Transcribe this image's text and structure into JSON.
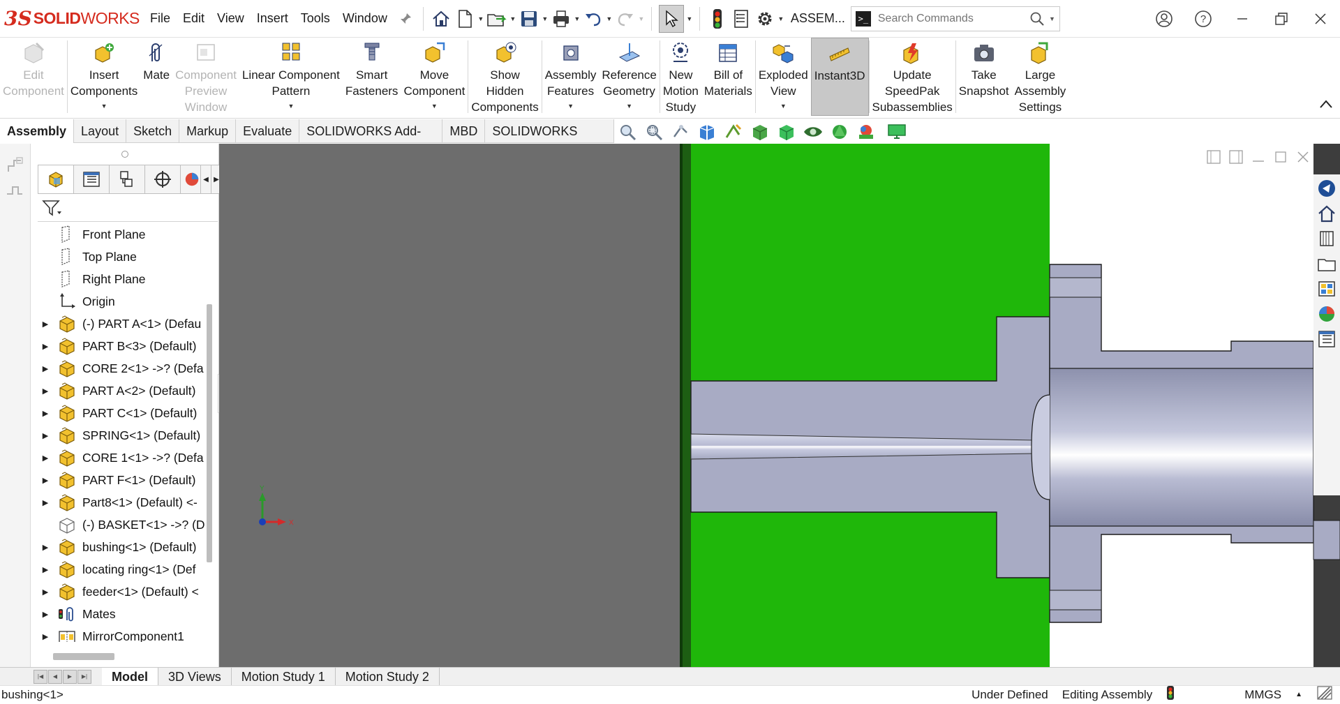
{
  "app": {
    "brand_ds": "3S",
    "brand_solid": "SOLID",
    "brand_works": "WORKS",
    "document_name": "ASSEM..."
  },
  "menu": [
    "File",
    "Edit",
    "View",
    "Insert",
    "Tools",
    "Window"
  ],
  "search": {
    "placeholder": "Search Commands",
    "prompt_glyph": ">_"
  },
  "command_manager": [
    {
      "id": "edit-component",
      "lines": [
        "Edit",
        "Component"
      ],
      "icon": "edit-component-icon",
      "enabled": false,
      "dropdown": false
    },
    {
      "id": "insert-components",
      "lines": [
        "Insert",
        "Components"
      ],
      "icon": "insert-components-icon",
      "enabled": true,
      "dropdown": true
    },
    {
      "id": "mate",
      "lines": [
        "Mate"
      ],
      "icon": "mate-paperclip-icon",
      "enabled": true,
      "dropdown": false
    },
    {
      "id": "component-preview-window",
      "lines": [
        "Component",
        "Preview",
        "Window"
      ],
      "icon": "preview-window-icon",
      "enabled": false,
      "dropdown": false
    },
    {
      "id": "linear-component-pattern",
      "lines": [
        "Linear Component",
        "Pattern"
      ],
      "icon": "linear-pattern-icon",
      "enabled": true,
      "dropdown": true
    },
    {
      "id": "smart-fasteners",
      "lines": [
        "Smart",
        "Fasteners"
      ],
      "icon": "smart-fasteners-icon",
      "enabled": true,
      "dropdown": false
    },
    {
      "id": "move-component",
      "lines": [
        "Move",
        "Component"
      ],
      "icon": "move-component-icon",
      "enabled": true,
      "dropdown": true
    },
    {
      "id": "show-hidden-components",
      "lines": [
        "Show",
        "Hidden",
        "Components"
      ],
      "icon": "show-hidden-icon",
      "enabled": true,
      "dropdown": false
    },
    {
      "id": "assembly-features",
      "lines": [
        "Assembly",
        "Features"
      ],
      "icon": "assembly-features-icon",
      "enabled": true,
      "dropdown": true
    },
    {
      "id": "reference-geometry",
      "lines": [
        "Reference",
        "Geometry"
      ],
      "icon": "reference-geometry-icon",
      "enabled": true,
      "dropdown": true
    },
    {
      "id": "new-motion-study",
      "lines": [
        "New",
        "Motion",
        "Study"
      ],
      "icon": "motion-study-icon",
      "enabled": true,
      "dropdown": false
    },
    {
      "id": "bill-of-materials",
      "lines": [
        "Bill of",
        "Materials"
      ],
      "icon": "bill-of-materials-icon",
      "enabled": true,
      "dropdown": false
    },
    {
      "id": "exploded-view",
      "lines": [
        "Exploded",
        "View"
      ],
      "icon": "exploded-view-icon",
      "enabled": true,
      "dropdown": true
    },
    {
      "id": "instant3d",
      "lines": [
        "Instant3D"
      ],
      "icon": "instant3d-icon",
      "enabled": true,
      "dropdown": false,
      "active": true
    },
    {
      "id": "update-speedpak",
      "lines": [
        "Update",
        "SpeedPak",
        "Subassemblies"
      ],
      "icon": "speedpak-icon",
      "enabled": true,
      "dropdown": false
    },
    {
      "id": "take-snapshot",
      "lines": [
        "Take",
        "Snapshot"
      ],
      "icon": "camera-icon",
      "enabled": true,
      "dropdown": false
    },
    {
      "id": "large-assembly-settings",
      "lines": [
        "Large",
        "Assembly",
        "Settings"
      ],
      "icon": "large-assembly-icon",
      "enabled": true,
      "dropdown": false
    }
  ],
  "tabs": [
    {
      "label": "Assembly",
      "active": true
    },
    {
      "label": "Layout"
    },
    {
      "label": "Sketch"
    },
    {
      "label": "Markup"
    },
    {
      "label": "Evaluate"
    },
    {
      "label": "SOLIDWORKS Add-Ins"
    },
    {
      "label": "MBD"
    },
    {
      "label": "SOLIDWORKS CAM"
    }
  ],
  "tree": [
    {
      "label": "Front Plane",
      "icon": "plane-icon",
      "expandable": false
    },
    {
      "label": "Top Plane",
      "icon": "plane-icon",
      "expandable": false
    },
    {
      "label": "Right Plane",
      "icon": "plane-icon",
      "expandable": false
    },
    {
      "label": "Origin",
      "icon": "origin-icon",
      "expandable": false
    },
    {
      "label": "(-) PART A<1> (Defau",
      "icon": "part-icon",
      "expandable": true
    },
    {
      "label": "PART B<3> (Default)",
      "icon": "part-icon",
      "expandable": true
    },
    {
      "label": "CORE 2<1> ->? (Defa",
      "icon": "part-icon",
      "expandable": true
    },
    {
      "label": "PART A<2> (Default)",
      "icon": "part-icon",
      "expandable": true
    },
    {
      "label": "PART C<1> (Default)",
      "icon": "part-icon",
      "expandable": true
    },
    {
      "label": "SPRING<1> (Default)",
      "icon": "part-icon",
      "expandable": true
    },
    {
      "label": "CORE 1<1> ->? (Defa",
      "icon": "part-icon",
      "expandable": true
    },
    {
      "label": "PART F<1> (Default)",
      "icon": "part-icon",
      "expandable": true
    },
    {
      "label": "Part8<1> (Default) <-",
      "icon": "part-icon",
      "expandable": true
    },
    {
      "label": "(-) BASKET<1> ->? (D",
      "icon": "part-hidden-icon",
      "expandable": false
    },
    {
      "label": "bushing<1> (Default)",
      "icon": "part-icon",
      "expandable": true
    },
    {
      "label": "locating ring<1> (Def",
      "icon": "part-icon",
      "expandable": true
    },
    {
      "label": "feeder<1> (Default) <",
      "icon": "part-icon",
      "expandable": true
    },
    {
      "label": "Mates",
      "icon": "mates-icon",
      "expandable": true
    },
    {
      "label": "MirrorComponent1",
      "icon": "mirror-component-icon",
      "expandable": true
    }
  ],
  "triad": {
    "y": "Y",
    "x": "X"
  },
  "bottom_tabs": [
    {
      "label": "Model",
      "active": true
    },
    {
      "label": "3D Views"
    },
    {
      "label": "Motion Study 1"
    },
    {
      "label": "Motion Study 2"
    }
  ],
  "status": {
    "selection": "bushing<1>",
    "definition": "Under Defined",
    "mode": "Editing Assembly",
    "units": "MMGS"
  },
  "colors": {
    "brand_red": "#d52b1e",
    "model_green": "#1fb70a",
    "model_steel": "#a8abc4",
    "viewport_gray": "#6d6d6d",
    "part_yellow": "#f2c12e"
  }
}
